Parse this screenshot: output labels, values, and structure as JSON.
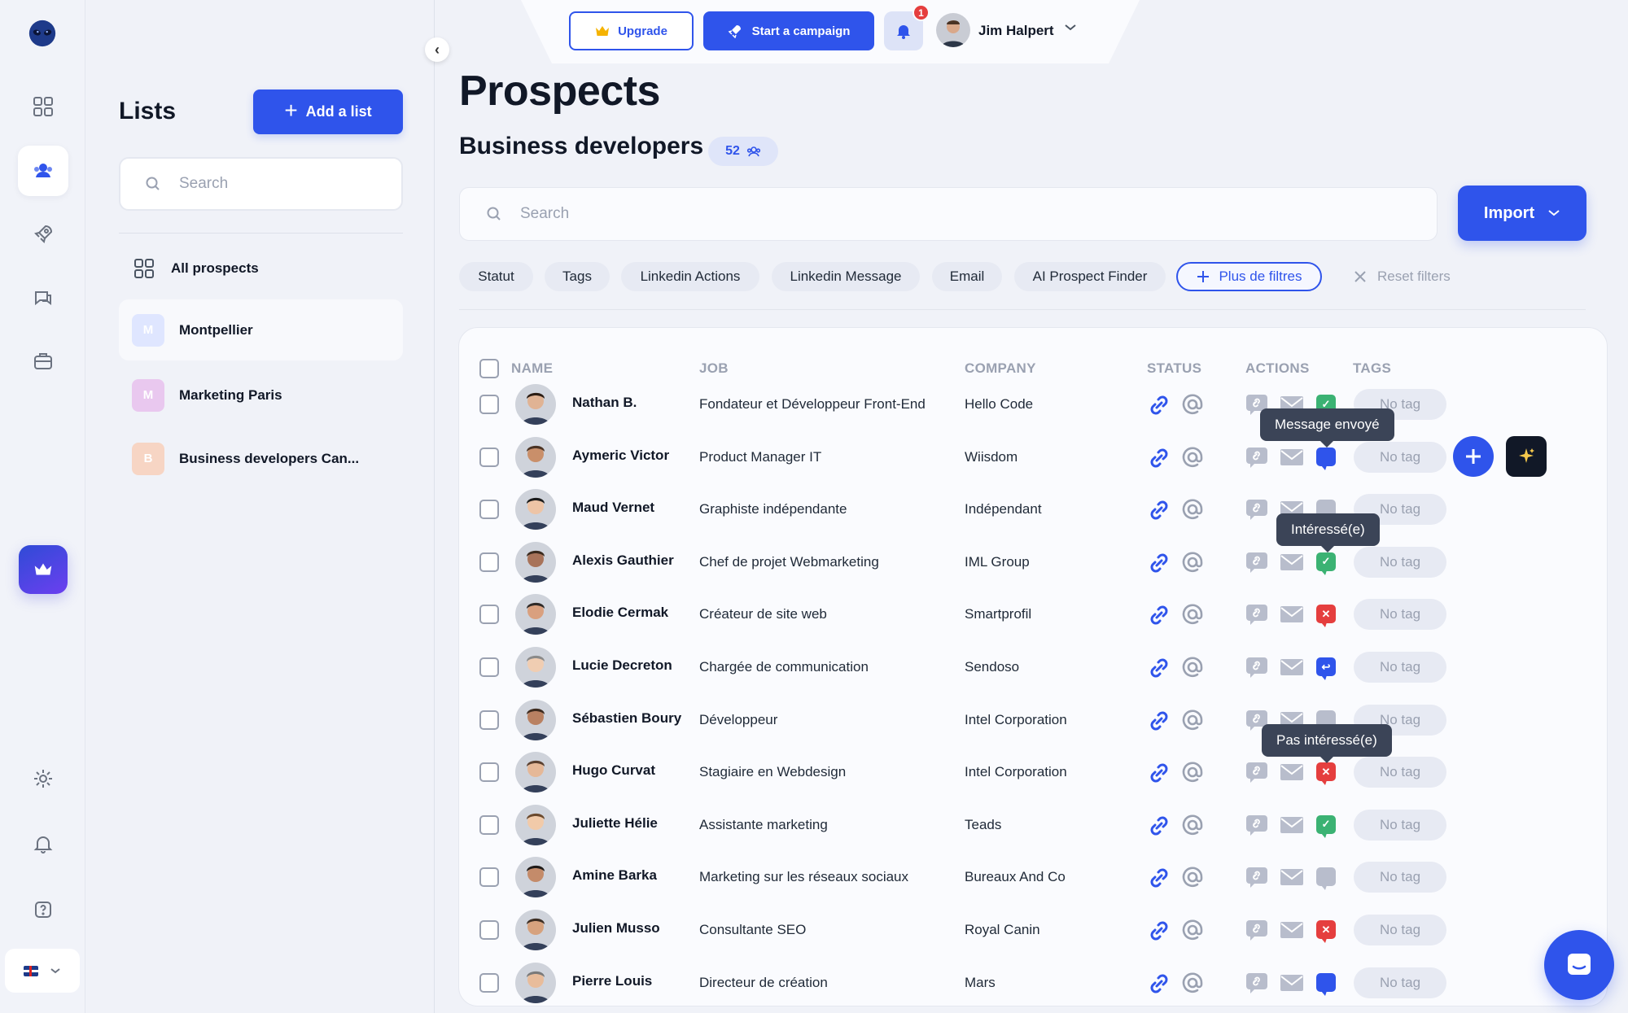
{
  "topbar": {
    "upgrade_label": "Upgrade",
    "campaign_label": "Start a campaign",
    "notification_count": "1",
    "user_name": "Jim Halpert"
  },
  "sidebar": {
    "lists_title": "Lists",
    "add_list_label": "Add a list",
    "search_placeholder": "Search",
    "items": [
      {
        "label": "All prospects",
        "icon": "grid-icon"
      },
      {
        "label": "Montpellier",
        "badge": "M",
        "badge_color": "#dfe6ff"
      },
      {
        "label": "Marketing Paris",
        "badge": "M",
        "badge_color": "#e9c8ef"
      },
      {
        "label": "Business developers Can...",
        "badge": "B",
        "badge_color": "#f7d5c4"
      }
    ]
  },
  "page": {
    "title": "Prospects",
    "list_name": "Business developers",
    "count": "52",
    "search_placeholder": "Search",
    "import_label": "Import"
  },
  "filters": {
    "chips": [
      "Statut",
      "Tags",
      "Linkedin Actions",
      "Linkedin Message",
      "Email",
      "AI Prospect Finder"
    ],
    "more_label": "Plus de filtres",
    "reset_label": "Reset filters"
  },
  "table": {
    "headers": {
      "name": "NAME",
      "job": "JOB",
      "company": "COMPANY",
      "status": "STATUS",
      "actions": "ACTIONS",
      "tags": "TAGS"
    },
    "rows": [
      {
        "name": "Nathan B.",
        "job": "Fondateur et Développeur Front-End",
        "company": "Hello Code",
        "message_state": "interested",
        "tag": "No tag"
      },
      {
        "name": "Aymeric Victor",
        "job": "Product Manager IT",
        "company": "Wiisdom",
        "message_state": "sent",
        "tag": "No tag"
      },
      {
        "name": "Maud Vernet",
        "job": "Graphiste indépendante",
        "company": "Indépendant",
        "message_state": "none",
        "tag": "No tag"
      },
      {
        "name": "Alexis Gauthier",
        "job": "Chef de projet Webmarketing",
        "company": "IML Group",
        "message_state": "interested",
        "tag": "No tag"
      },
      {
        "name": "Elodie Cermak",
        "job": "Créateur de site web",
        "company": "Smartprofil",
        "message_state": "not_interested",
        "tag": "No tag"
      },
      {
        "name": "Lucie Decreton",
        "job": "Chargée de communication",
        "company": "Sendoso",
        "message_state": "replied",
        "tag": "No tag"
      },
      {
        "name": "Sébastien Boury",
        "job": "Développeur",
        "company": "Intel Corporation",
        "message_state": "none",
        "tag": "No tag"
      },
      {
        "name": "Hugo Curvat",
        "job": "Stagiaire en Webdesign",
        "company": "Intel Corporation",
        "message_state": "not_interested",
        "tag": "No tag"
      },
      {
        "name": "Juliette Hélie",
        "job": "Assistante marketing",
        "company": "Teads",
        "message_state": "interested",
        "tag": "No tag"
      },
      {
        "name": "Amine Barka",
        "job": "Marketing sur les réseaux sociaux",
        "company": "Bureaux And Co",
        "message_state": "none",
        "tag": "No tag"
      },
      {
        "name": "Julien Musso",
        "job": "Consultante SEO",
        "company": "Royal Canin",
        "message_state": "not_interested",
        "tag": "No tag"
      },
      {
        "name": "Pierre Louis",
        "job": "Directeur de création",
        "company": "Mars",
        "message_state": "sent",
        "tag": "No tag"
      }
    ]
  },
  "tooltips": {
    "message_sent": "Message envoyé",
    "interested": "Intéressé(e)",
    "not_interested": "Pas intéressé(e)"
  },
  "colors": {
    "accent": "#2f54eb",
    "interested": "#3bb273",
    "not_interested": "#e53e3e",
    "sent": "#2f54eb",
    "neutral": "#b8bdcc"
  }
}
